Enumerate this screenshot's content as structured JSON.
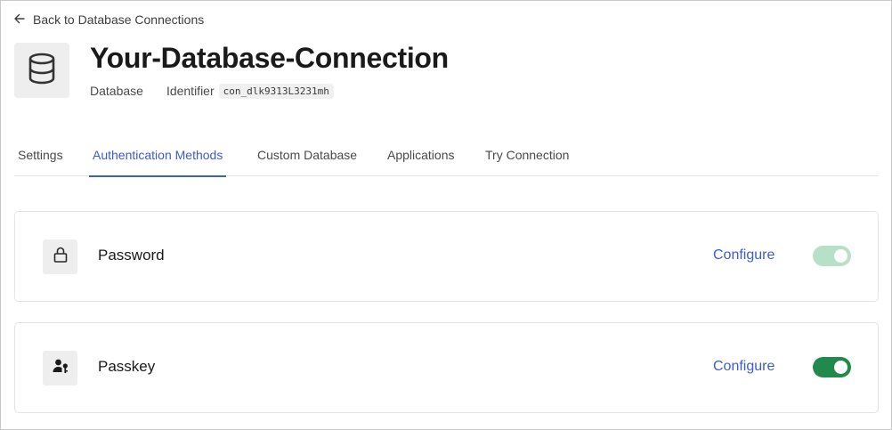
{
  "back_link": {
    "label": "Back to Database Connections"
  },
  "header": {
    "title": "Your-Database-Connection",
    "type": "Database",
    "identifier_label": "Identifier",
    "identifier_value": "con_dlk9313L3231mh"
  },
  "tabs": [
    {
      "label": "Settings",
      "active": false
    },
    {
      "label": "Authentication Methods",
      "active": true
    },
    {
      "label": "Custom Database",
      "active": false
    },
    {
      "label": "Applications",
      "active": false
    },
    {
      "label": "Try Connection",
      "active": false
    }
  ],
  "methods": [
    {
      "name": "Password",
      "icon": "lock-icon",
      "configure_label": "Configure",
      "enabled": true,
      "toggle_state": "on-disabled"
    },
    {
      "name": "Passkey",
      "icon": "user-key-icon",
      "configure_label": "Configure",
      "enabled": true,
      "toggle_state": "on"
    }
  ],
  "colors": {
    "accent": "#3e5bd1",
    "toggle_on": "#1f8a4c",
    "toggle_on_disabled": "#b8dfc7"
  }
}
